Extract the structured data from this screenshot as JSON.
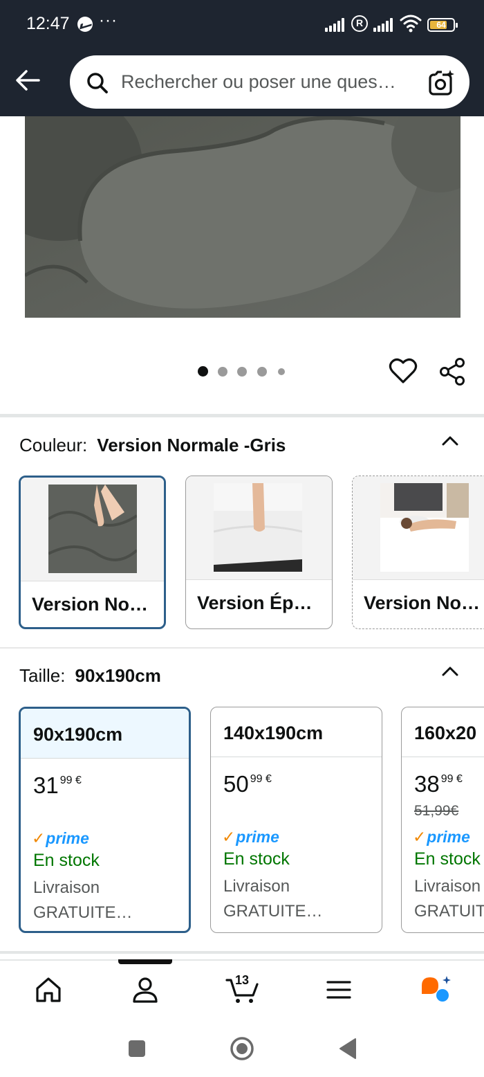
{
  "status_bar": {
    "time": "12:47",
    "dots": "···",
    "battery": "64",
    "icons": [
      "messenger-icon",
      "signal-icon",
      "registered-icon",
      "signal-icon",
      "wifi-icon",
      "battery-icon"
    ]
  },
  "header": {
    "search_placeholder": "Rechercher ou poser une ques…",
    "icons": [
      "back-arrow-icon",
      "search-icon",
      "camera-lens-icon"
    ]
  },
  "gallery": {
    "dot_count": 5,
    "active_index": 0,
    "icons": [
      "heart-icon",
      "share-icon"
    ]
  },
  "color": {
    "label": "Couleur:",
    "value": "Version Normale -Gris",
    "options": [
      {
        "name": "Version No…",
        "selected": true
      },
      {
        "name": "Version Ép…",
        "selected": false
      },
      {
        "name": "Version No…",
        "selected": false
      }
    ]
  },
  "size": {
    "label": "Taille:",
    "value": "90x190cm",
    "options": [
      {
        "size": "90x190cm",
        "price_whole": "31",
        "price_frac": "99 €",
        "was": "",
        "prime": "prime",
        "stock": "En stock",
        "delivery_1": "Livraison",
        "delivery_2": "GRATUITE…",
        "selected": true
      },
      {
        "size": "140x190cm",
        "price_whole": "50",
        "price_frac": "99 €",
        "was": "",
        "prime": "prime",
        "stock": "En stock",
        "delivery_1": "Livraison",
        "delivery_2": "GRATUITE…",
        "selected": false
      },
      {
        "size": "160x20",
        "price_whole": "38",
        "price_frac": "99 €",
        "was": "51,99€",
        "prime": "prime",
        "stock": "En stock",
        "delivery_1": "Livraison",
        "delivery_2": "GRATUIT",
        "selected": false
      }
    ]
  },
  "bottom_nav": {
    "cart_count": "13",
    "items": [
      "home-icon",
      "account-icon",
      "cart-icon",
      "menu-icon",
      "rufus-icon"
    ]
  },
  "colors": {
    "header_bg": "#1e2530",
    "selected_border": "#2d5f8a",
    "in_stock": "#007600",
    "prime_blue": "#1a98ff",
    "prime_check": "#f08804"
  }
}
